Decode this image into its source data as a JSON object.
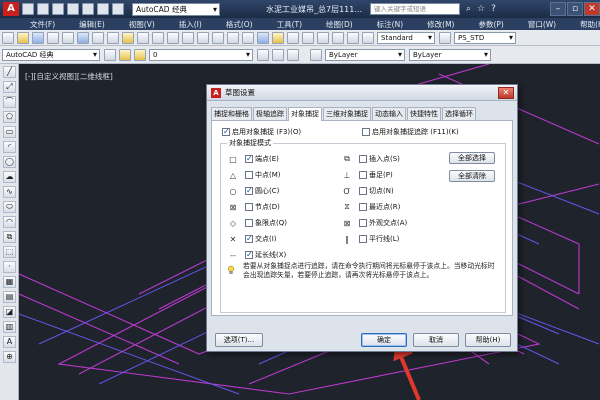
{
  "title_bar": {
    "workspace": "AutoCAD 经典",
    "document_title": "水泥工业媒吊_总7层111...",
    "search_placeholder": "键入关键字或短语"
  },
  "menu": [
    "文件(F)",
    "编辑(E)",
    "视图(V)",
    "插入(I)",
    "格式(O)",
    "工具(T)",
    "绘图(D)",
    "标注(N)",
    "修改(M)",
    "参数(P)",
    "窗口(W)",
    "帮助(H)"
  ],
  "toolbar1": {
    "text_style": "Standard",
    "table_style": "PS_STD"
  },
  "toolbar2": {
    "workspace": "AutoCAD 经典",
    "layer": "0",
    "color": "ByLayer",
    "linetype": "ByLayer"
  },
  "canvas": {
    "view_label": "[-][自定义视图][二维线框]"
  },
  "dialog": {
    "title": "草图设置",
    "tabs": [
      "捕捉和栅格",
      "极轴追踪",
      "对象捕捉",
      "三维对象捕捉",
      "动态输入",
      "快捷特性",
      "选择循环"
    ],
    "enable_osnap": "启用对象捕捉 (F3)(O)",
    "enable_osnap_tracking": "启用对象捕捉追踪 (F11)(K)",
    "group_label": "对象捕捉模式",
    "modes_left": [
      {
        "label": "端点(E)",
        "checked": true,
        "symbol": "□"
      },
      {
        "label": "中点(M)",
        "checked": false,
        "symbol": "△"
      },
      {
        "label": "圆心(C)",
        "checked": true,
        "symbol": "○"
      },
      {
        "label": "节点(D)",
        "checked": false,
        "symbol": "⊠"
      },
      {
        "label": "象限点(Q)",
        "checked": false,
        "symbol": "◇"
      },
      {
        "label": "交点(I)",
        "checked": true,
        "symbol": "✕"
      },
      {
        "label": "延长线(X)",
        "checked": true,
        "symbol": "--"
      }
    ],
    "modes_right": [
      {
        "label": "插入点(S)",
        "checked": false,
        "symbol": "⧉"
      },
      {
        "label": "垂足(P)",
        "checked": false,
        "symbol": "⊥"
      },
      {
        "label": "切点(N)",
        "checked": false,
        "symbol": "Ơ"
      },
      {
        "label": "最近点(R)",
        "checked": false,
        "symbol": "⧖"
      },
      {
        "label": "外观交点(A)",
        "checked": false,
        "symbol": "⊠"
      },
      {
        "label": "平行线(L)",
        "checked": false,
        "symbol": "∥"
      }
    ],
    "select_all": "全部选择",
    "clear_all": "全部清除",
    "hint": "若要从对象捕捉点进行追踪，请在命令执行期间将光标悬停于该点上。当移动光标时会出现追踪矢量，若要停止追踪，请再次将光标悬停于该点上。",
    "options_button": "选项(T)...",
    "ok_button": "确定",
    "cancel_button": "取消",
    "help_button": "帮助(H)"
  },
  "colors": {
    "accent_arrow": "#e0382d",
    "wire_magenta": "#c23bd6",
    "wire_blue": "#6a5cff"
  }
}
